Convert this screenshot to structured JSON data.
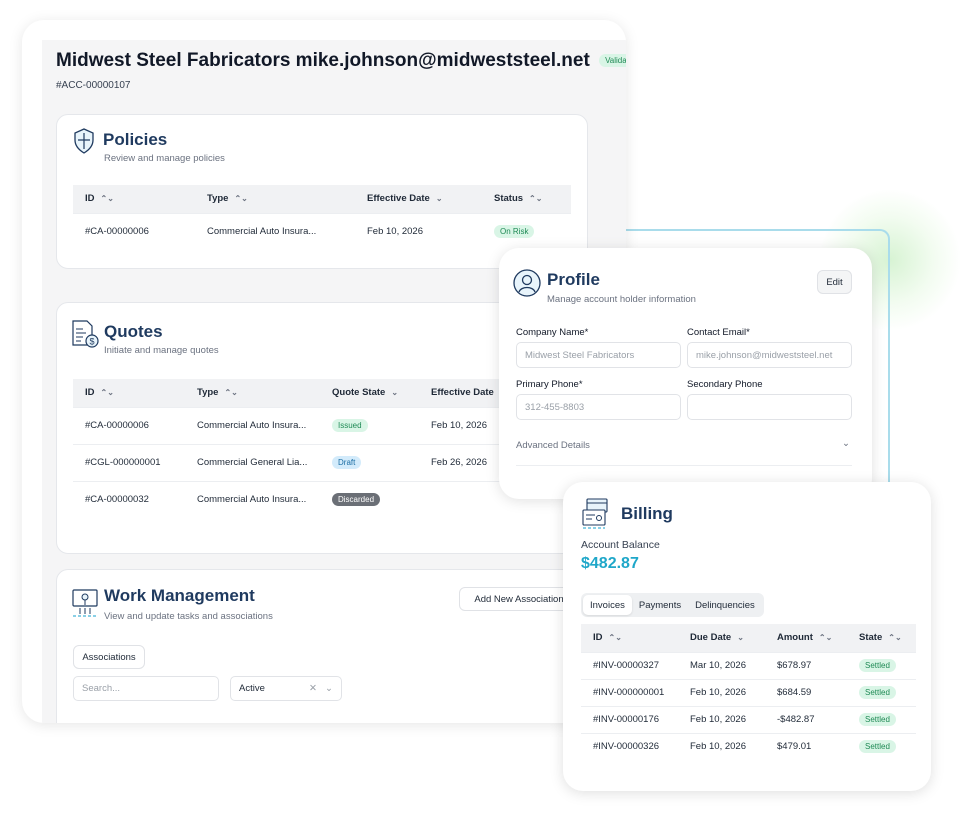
{
  "account": {
    "name": "Midwest Steel Fabricators mike.johnson@midweststeel.net",
    "status": "Validated",
    "id": "#ACC-00000107"
  },
  "policies": {
    "title": "Policies",
    "subtitle": "Review and manage policies",
    "columns": [
      "ID",
      "Type",
      "Effective Date",
      "Status"
    ],
    "rows": [
      {
        "id": "#CA-00000006",
        "type": "Commercial Auto Insura...",
        "date": "Feb 10, 2026",
        "status": "On Risk"
      }
    ]
  },
  "quotes": {
    "title": "Quotes",
    "subtitle": "Initiate and manage quotes",
    "columns": [
      "ID",
      "Type",
      "Quote State",
      "Effective Date"
    ],
    "rows": [
      {
        "id": "#CA-00000006",
        "type": "Commercial Auto Insura...",
        "state": "Issued",
        "date": "Feb 10, 2026"
      },
      {
        "id": "#CGL-000000001",
        "type": "Commercial General Lia...",
        "state": "Draft",
        "date": "Feb 26, 2026"
      },
      {
        "id": "#CA-00000032",
        "type": "Commercial Auto Insura...",
        "state": "Discarded",
        "date": ""
      }
    ]
  },
  "work": {
    "title": "Work Management",
    "subtitle": "View and update tasks and associations",
    "add_button": "Add New Association",
    "associations_button": "Associations",
    "search_placeholder": "Search...",
    "filter_value": "Active"
  },
  "profile": {
    "title": "Profile",
    "subtitle": "Manage account holder information",
    "edit": "Edit",
    "company_label": "Company Name*",
    "company_value": "Midwest Steel Fabricators",
    "email_label": "Contact Email*",
    "email_value": "mike.johnson@midweststeel.net",
    "phone_label": "Primary Phone*",
    "phone_value": "312-455-8803",
    "phone2_label": "Secondary Phone",
    "phone2_value": "",
    "advanced": "Advanced Details"
  },
  "billing": {
    "title": "Billing",
    "balance_label": "Account Balance",
    "balance": "$482.87",
    "tabs": [
      "Invoices",
      "Payments",
      "Delinquencies"
    ],
    "columns": [
      "ID",
      "Due Date",
      "Amount",
      "State"
    ],
    "rows": [
      {
        "id": "#INV-00000327",
        "date": "Mar 10, 2026",
        "amount": "$678.97",
        "state": "Settled"
      },
      {
        "id": "#INV-000000001",
        "date": "Feb 10, 2026",
        "amount": "$684.59",
        "state": "Settled"
      },
      {
        "id": "#INV-00000176",
        "date": "Feb 10, 2026",
        "amount": "-$482.87",
        "state": "Settled"
      },
      {
        "id": "#INV-00000326",
        "date": "Feb 10, 2026",
        "amount": "$479.01",
        "state": "Settled"
      }
    ]
  },
  "colors": {
    "accent": "#1fa7c9",
    "link": "#2f5bb7",
    "heading": "#1f3a5f"
  }
}
